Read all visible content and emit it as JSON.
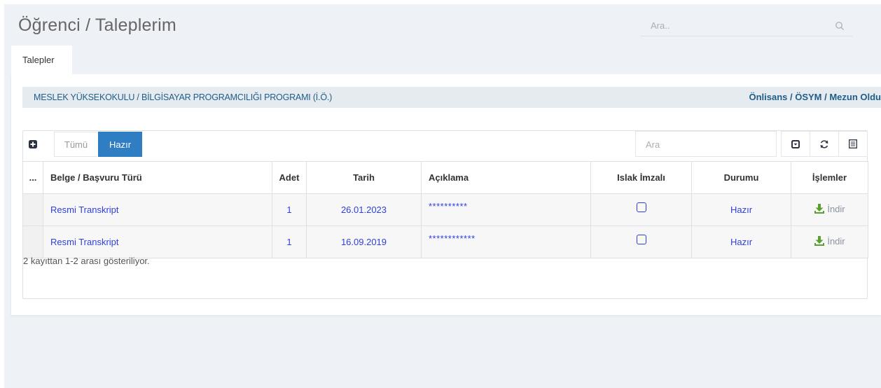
{
  "page": {
    "title": "Öğrenci / Taleplerim"
  },
  "top_search": {
    "placeholder": "Ara.."
  },
  "tabs": [
    {
      "label": "Talepler"
    }
  ],
  "program": {
    "name": "MESLEK YÜKSEKOKULU / BİLGİSAYAR PROGRAMCILIĞI PROGRAMI (İ.Ö.)",
    "status": "Önlisans / ÖSYM / Mezun Oldu"
  },
  "toolbar": {
    "filter_all": "Tümü",
    "filter_ready": "Hazır",
    "search_placeholder": "Ara"
  },
  "table": {
    "headers": [
      "...",
      "Belge / Başvuru Türü",
      "Adet",
      "Tarih",
      "Açıklama",
      "Islak İmzalı",
      "Durumu",
      "İşlemler"
    ],
    "rows": [
      {
        "type": "Resmi Transkript",
        "count": "1",
        "date": "26.01.2023",
        "description": "**********",
        "wet_signed": false,
        "status": "Hazır",
        "action": "İndir"
      },
      {
        "type": "Resmi Transkript",
        "count": "1",
        "date": "16.09.2019",
        "description": "************",
        "wet_signed": false,
        "status": "Hazır",
        "action": "İndir"
      }
    ]
  },
  "footer": {
    "summary": "2 kayıttan 1-2 arası gösteriliyor."
  },
  "colors": {
    "accent": "#2f7dc2",
    "link": "#2d3fe0",
    "program_text": "#1f5d8a",
    "download_icon": "#5ba02e"
  },
  "icons": {
    "search": "search-icon",
    "add": "plus-square-icon",
    "column_toggle": "dropdown-icon",
    "refresh": "refresh-icon",
    "list": "list-icon",
    "download": "download-icon"
  }
}
